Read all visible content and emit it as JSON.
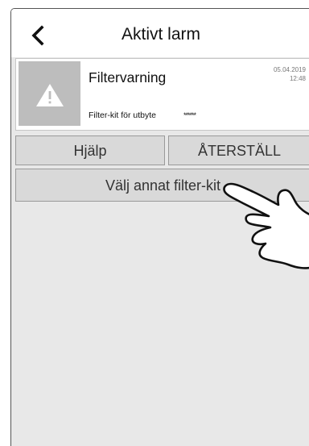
{
  "header": {
    "title": "Aktivt larm",
    "back_icon": "chevron-left-icon"
  },
  "alarm": {
    "icon": "warning-triangle-icon",
    "name": "Filtervarning",
    "date": "05.04.2019",
    "time": "12:48",
    "description": "Filter-kit för utbyte",
    "masked_value": "******"
  },
  "actions": {
    "help_label": "Hjälp",
    "reset_label": "ÅTERSTÄLL",
    "select_filter_label": "Välj annat filter-kit"
  },
  "gesture": {
    "icon": "tap-hand-icon"
  },
  "colors": {
    "background": "#e8e8e8",
    "button": "#d9d9d9",
    "warning_box": "#bdbdbd"
  }
}
